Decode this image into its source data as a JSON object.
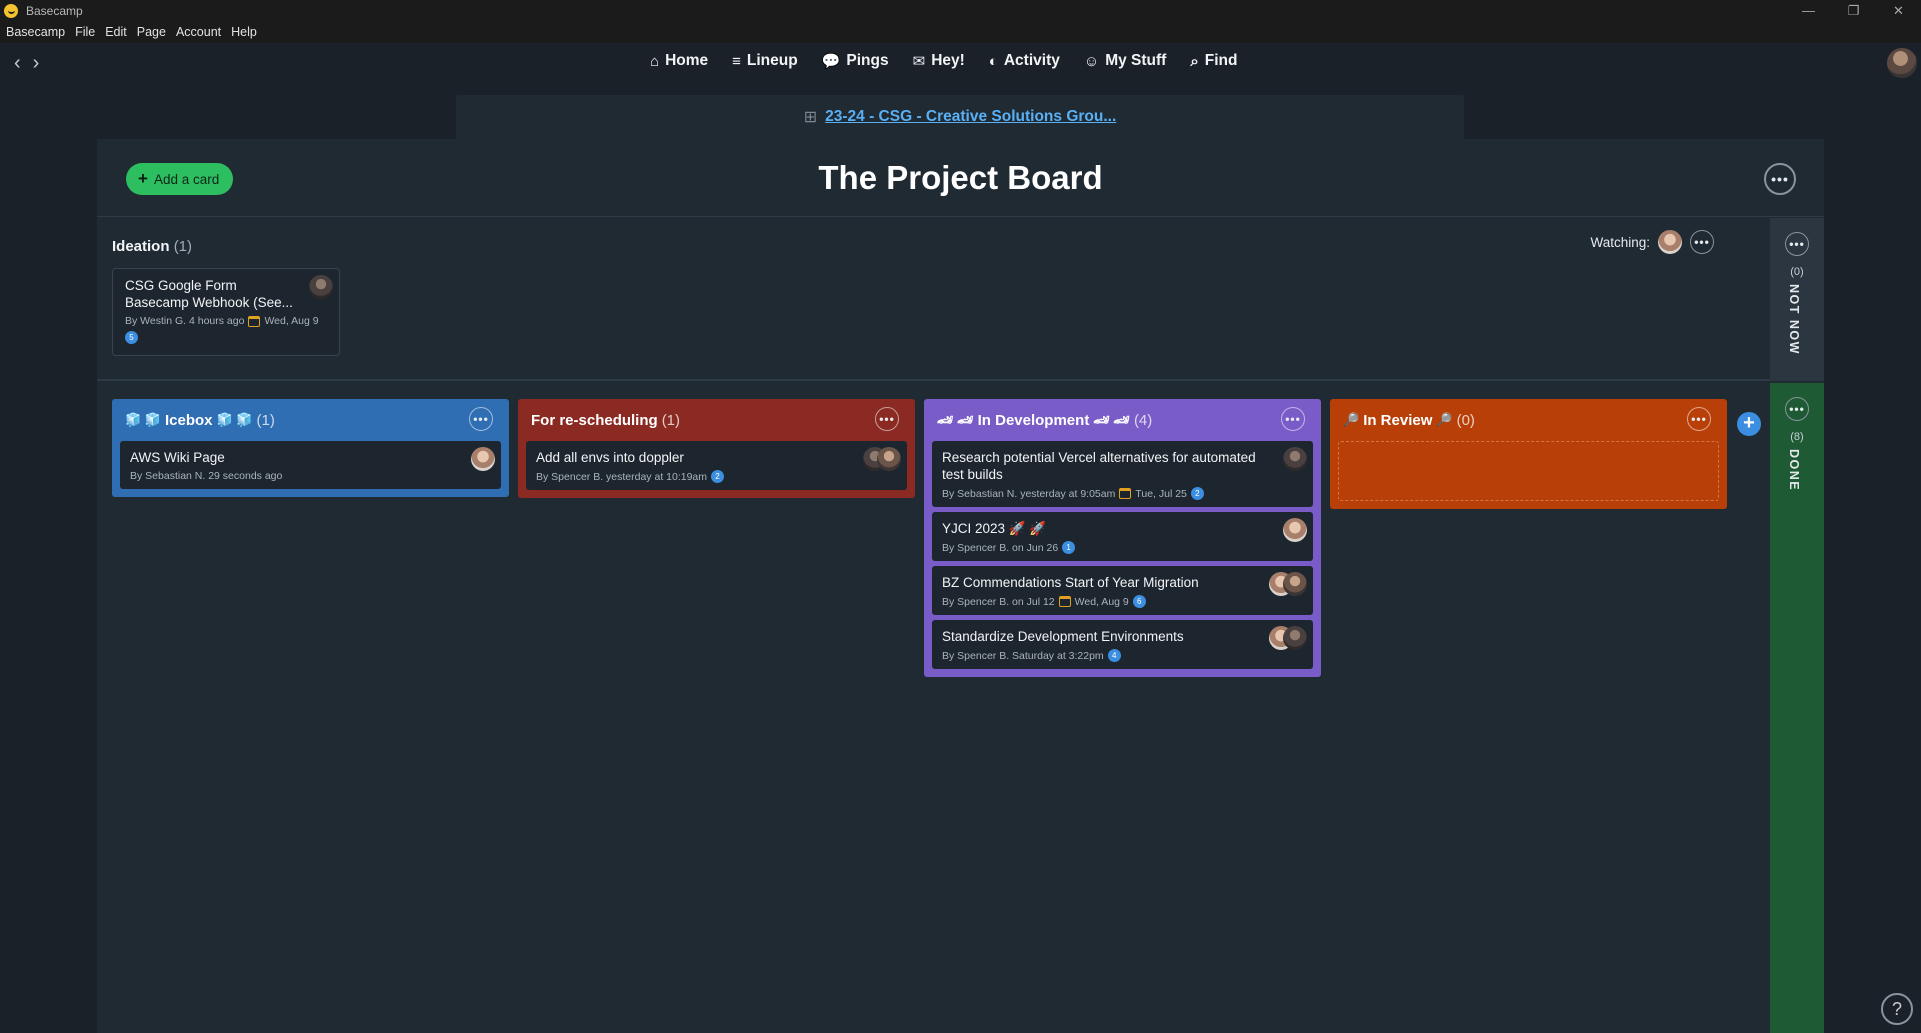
{
  "window": {
    "title": "Basecamp",
    "controls": [
      "—",
      "❐",
      "✕"
    ]
  },
  "menu": [
    "Basecamp",
    "File",
    "Edit",
    "Page",
    "Account",
    "Help"
  ],
  "nav": {
    "back": "‹",
    "forward": "›",
    "links": [
      {
        "label": "Home",
        "icon": "home-icon",
        "glyph": "⌂"
      },
      {
        "label": "Lineup",
        "icon": "lineup-icon",
        "glyph": "≡"
      },
      {
        "label": "Pings",
        "icon": "pings-icon",
        "glyph": "💬"
      },
      {
        "label": "Hey!",
        "icon": "hey-icon",
        "glyph": "✉"
      },
      {
        "label": "Activity",
        "icon": "activity-icon",
        "glyph": "◐"
      },
      {
        "label": "My Stuff",
        "icon": "mystuff-icon",
        "glyph": "☺"
      },
      {
        "label": "Find",
        "icon": "find-icon",
        "glyph": "⌕"
      }
    ]
  },
  "breadcrumb": {
    "icon": "⊞",
    "label": "23-24 - CSG - Creative Solutions Grou..."
  },
  "board": {
    "title": "The Project Board",
    "add_card_label": "Add a card",
    "menu_glyph": "•••"
  },
  "ideation": {
    "title": "Ideation",
    "count": "(1)",
    "watching_label": "Watching:",
    "card": {
      "title": "CSG Google Form Basecamp Webhook (See...",
      "meta": "By Westin G. 4 hours ago",
      "due": "Wed, Aug 9",
      "badge": "5"
    }
  },
  "side_strips": {
    "not_now": {
      "count": "(0)",
      "label": "NOT NOW"
    },
    "done": {
      "count": "(8)",
      "label": "DONE"
    }
  },
  "columns": {
    "icebox": {
      "title": "Icebox",
      "emoji_left": "🧊 🧊",
      "emoji_right": "🧊 🧊",
      "count": "(1)",
      "cards": [
        {
          "title": "AWS Wiki Page",
          "meta": "By Sebastian N. 29 seconds ago"
        }
      ]
    },
    "resched": {
      "title": "For re-scheduling",
      "count": "(1)",
      "cards": [
        {
          "title": "Add all envs into doppler",
          "meta": "By Spencer B. yesterday at 10:19am",
          "badge": "2"
        }
      ]
    },
    "indev": {
      "title": "In Development",
      "emoji_left": "🏎 🏎",
      "emoji_right": "🏎 🏎",
      "count": "(4)",
      "cards": [
        {
          "title": "Research potential Vercel alternatives for automated test builds",
          "meta": "By Sebastian N. yesterday at 9:05am",
          "due": "Tue, Jul 25",
          "badge": "2"
        },
        {
          "title": "YJCI 2023 🚀 🚀",
          "meta": "By Spencer B. on Jun 26",
          "badge": "1"
        },
        {
          "title": "BZ Commendations Start of Year Migration",
          "meta": "By Spencer B. on Jul 12",
          "due": "Wed, Aug 9",
          "badge": "6"
        },
        {
          "title": "Standardize Development Environments",
          "meta": "By Spencer B. Saturday at 3:22pm",
          "badge": "4"
        }
      ]
    },
    "review": {
      "title": "In Review",
      "emoji_left": "🔎",
      "emoji_right": "🔎",
      "count": "(0)"
    }
  },
  "add_column_glyph": "+",
  "help_glyph": "?"
}
